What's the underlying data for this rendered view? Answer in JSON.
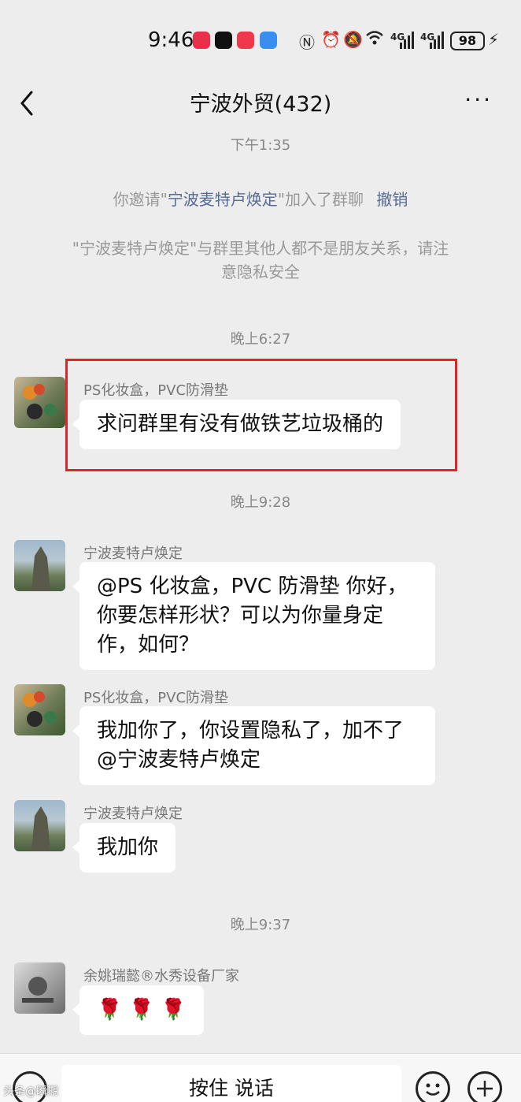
{
  "status_bar": {
    "time": "9:46",
    "battery": "98",
    "network_1": "4G",
    "network_2": "4G",
    "icons": [
      "app-red-icon",
      "tiktok-icon",
      "app-red2-icon",
      "app-blue-icon",
      "nfc-icon",
      "alarm-icon",
      "mute-icon",
      "wifi-icon",
      "signal-icon",
      "charging-icon"
    ]
  },
  "nav": {
    "title": "宁波外贸(432)",
    "more_label": "···"
  },
  "chat": {
    "timestamps": [
      "下午1:35",
      "晚上6:27",
      "晚上9:28",
      "晚上9:37"
    ],
    "system_invite_prefix": "你邀请\"",
    "system_invite_name": "宁波麦特卢焕定",
    "system_invite_suffix": "\"加入了群聊",
    "system_invite_action": "撤销",
    "system_privacy_line1": "\"宁波麦特卢焕定\"与群里其他人都不是朋友关系，请注",
    "system_privacy_line2": "意隐私安全",
    "messages": [
      {
        "sender": "PS化妆盒，PVC防滑垫",
        "lines": [
          "求问群里有没有做铁艺垃圾桶的"
        ]
      },
      {
        "sender": "宁波麦特卢焕定",
        "lines": [
          "@PS 化妆盒，PVC 防滑垫  你好，",
          "你要怎样形状？可以为你量身定",
          "作，如何？"
        ]
      },
      {
        "sender": "PS化妆盒，PVC防滑垫",
        "lines": [
          "我加你了，你设置隐私了，加不了",
          "@宁波麦特卢焕定"
        ]
      },
      {
        "sender": "宁波麦特卢焕定",
        "lines": [
          "我加你"
        ]
      },
      {
        "sender": "余姚瑞懿®水秀设备厂家",
        "lines": [
          "🌹 🌹 🌹"
        ]
      }
    ]
  },
  "input_bar": {
    "hold_to_talk": "按住 说话"
  },
  "watermark": "头条@瞬期"
}
